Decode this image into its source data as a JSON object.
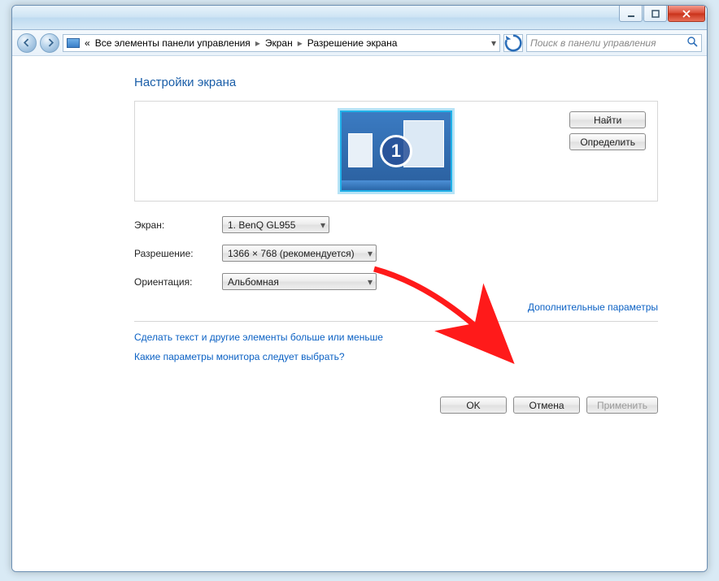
{
  "breadcrumb": {
    "prefix": "«",
    "seg1": "Все элементы панели управления",
    "seg2": "Экран",
    "seg3": "Разрешение экрана"
  },
  "search": {
    "placeholder": "Поиск в панели управления"
  },
  "page": {
    "title": "Настройки экрана",
    "monitor_number": "1",
    "btn_find": "Найти",
    "btn_detect": "Определить"
  },
  "form": {
    "screen_label": "Экран:",
    "screen_value": "1. BenQ GL955",
    "resolution_label": "Разрешение:",
    "resolution_value": "1366 × 768 (рекомендуется)",
    "orientation_label": "Ориентация:",
    "orientation_value": "Альбомная"
  },
  "links": {
    "advanced": "Дополнительные параметры",
    "scale": "Сделать текст и другие элементы больше или меньше",
    "which": "Какие параметры монитора следует выбрать?"
  },
  "buttons": {
    "ok": "OK",
    "cancel": "Отмена",
    "apply": "Применить"
  }
}
